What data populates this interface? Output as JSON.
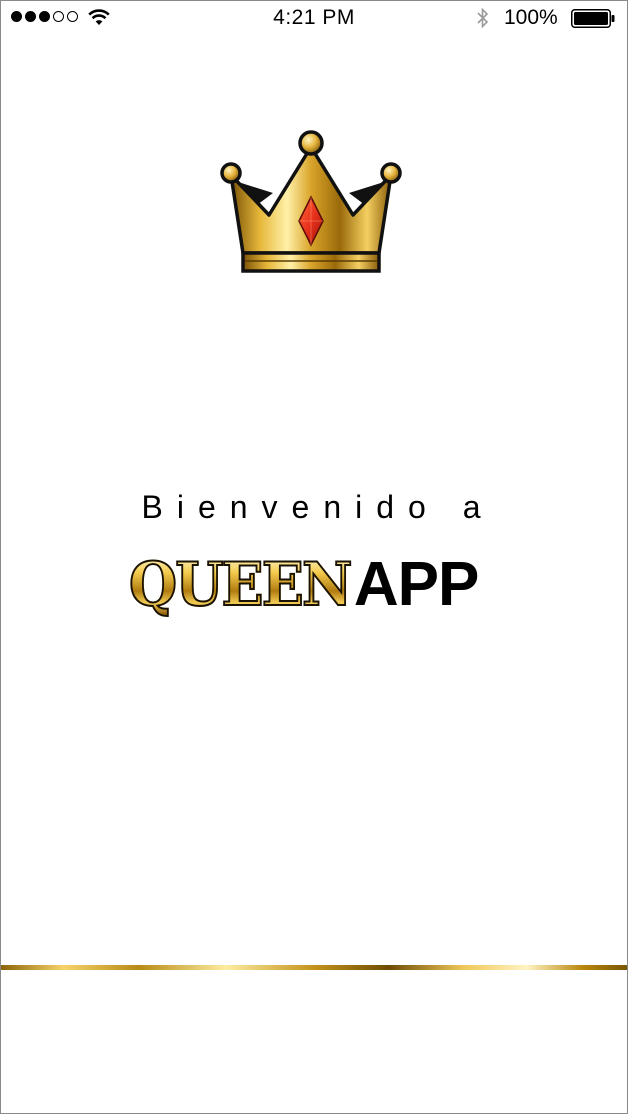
{
  "status_bar": {
    "signal_bars_filled": 3,
    "signal_bars_total": 5,
    "time": "4:21 PM",
    "battery_percent": "100%"
  },
  "splash": {
    "welcome_text": "Bienvenido a",
    "brand_part1": "QUEEN",
    "brand_part2": "APP"
  },
  "icons": {
    "crown": "crown-icon",
    "wifi": "wifi-icon",
    "bluetooth": "bluetooth-icon",
    "battery": "battery-icon"
  },
  "colors": {
    "gold_dark": "#8a6408",
    "gold_light": "#fdeca0",
    "gem_red": "#e8321c",
    "text": "#000000",
    "background": "#ffffff"
  }
}
